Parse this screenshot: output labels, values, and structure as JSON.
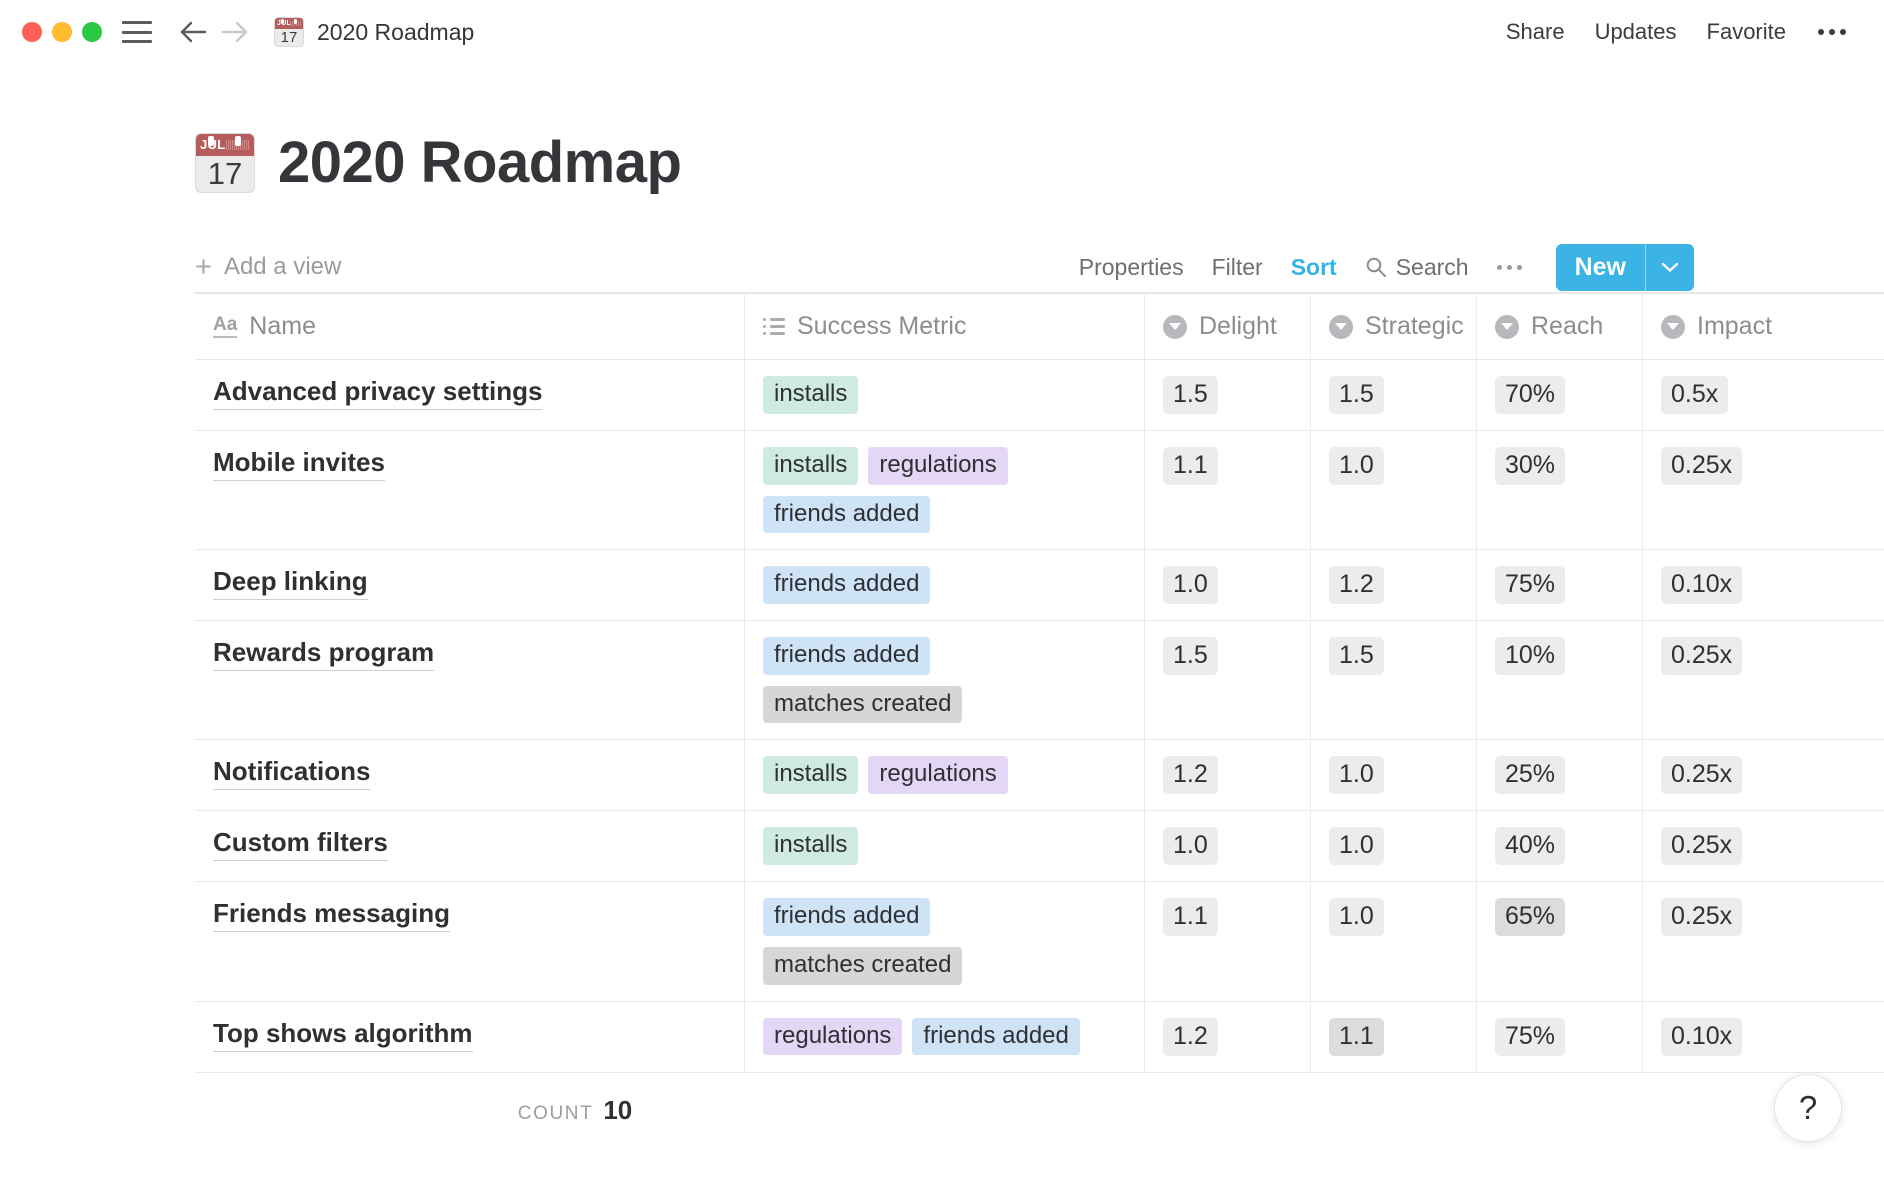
{
  "titlebar": {
    "breadcrumb_title": "2020 Roadmap",
    "calendar_month": "JUL",
    "calendar_day": "17",
    "actions": [
      {
        "label": "Share",
        "name": "share-button"
      },
      {
        "label": "Updates",
        "name": "updates-button"
      },
      {
        "label": "Favorite",
        "name": "favorite-button"
      }
    ]
  },
  "page": {
    "title": "2020 Roadmap",
    "calendar_month": "JUL",
    "calendar_day": "17"
  },
  "viewbar": {
    "add_view_label": "Add a view",
    "properties_label": "Properties",
    "filter_label": "Filter",
    "sort_label": "Sort",
    "search_label": "Search",
    "new_label": "New",
    "accent_color": "#3cb3e5",
    "active_item": "Sort"
  },
  "table": {
    "columns": [
      {
        "label": "Name",
        "icon": "text-aa-icon"
      },
      {
        "label": "Success Metric",
        "icon": "multi-select-list-icon"
      },
      {
        "label": "Delight",
        "icon": "select-icon"
      },
      {
        "label": "Strategic",
        "icon": "select-icon"
      },
      {
        "label": "Reach",
        "icon": "select-icon"
      },
      {
        "label": "Impact",
        "icon": "select-icon"
      }
    ],
    "rows": [
      {
        "name": "Advanced privacy settings",
        "metrics": [
          {
            "label": "installs",
            "color": "green"
          }
        ],
        "delight": "1.5",
        "delight_dark": false,
        "strategic": "1.5",
        "strategic_dark": false,
        "reach": "70%",
        "reach_dark": false,
        "impact": "0.5x",
        "impact_dark": false
      },
      {
        "name": "Mobile invites",
        "metrics": [
          {
            "label": "installs",
            "color": "green"
          },
          {
            "label": "regulations",
            "color": "purple"
          },
          {
            "label": "friends added",
            "color": "blue"
          }
        ],
        "delight": "1.1",
        "delight_dark": false,
        "strategic": "1.0",
        "strategic_dark": false,
        "reach": "30%",
        "reach_dark": false,
        "impact": "0.25x",
        "impact_dark": false
      },
      {
        "name": "Deep linking",
        "metrics": [
          {
            "label": "friends added",
            "color": "blue"
          }
        ],
        "delight": "1.0",
        "delight_dark": false,
        "strategic": "1.2",
        "strategic_dark": false,
        "reach": "75%",
        "reach_dark": false,
        "impact": "0.10x",
        "impact_dark": false
      },
      {
        "name": "Rewards program",
        "metrics": [
          {
            "label": "friends added",
            "color": "blue"
          },
          {
            "label": "matches created",
            "color": "gray"
          }
        ],
        "delight": "1.5",
        "delight_dark": false,
        "strategic": "1.5",
        "strategic_dark": false,
        "reach": "10%",
        "reach_dark": false,
        "impact": "0.25x",
        "impact_dark": false
      },
      {
        "name": "Notifications",
        "metrics": [
          {
            "label": "installs",
            "color": "green"
          },
          {
            "label": "regulations",
            "color": "purple"
          }
        ],
        "delight": "1.2",
        "delight_dark": false,
        "strategic": "1.0",
        "strategic_dark": false,
        "reach": "25%",
        "reach_dark": false,
        "impact": "0.25x",
        "impact_dark": false
      },
      {
        "name": "Custom filters",
        "metrics": [
          {
            "label": "installs",
            "color": "green"
          }
        ],
        "delight": "1.0",
        "delight_dark": false,
        "strategic": "1.0",
        "strategic_dark": false,
        "reach": "40%",
        "reach_dark": false,
        "impact": "0.25x",
        "impact_dark": false
      },
      {
        "name": "Friends messaging",
        "metrics": [
          {
            "label": "friends added",
            "color": "blue"
          },
          {
            "label": "matches created",
            "color": "gray"
          }
        ],
        "delight": "1.1",
        "delight_dark": false,
        "strategic": "1.0",
        "strategic_dark": false,
        "reach": "65%",
        "reach_dark": true,
        "impact": "0.25x",
        "impact_dark": false
      },
      {
        "name": "Top shows algorithm",
        "metrics": [
          {
            "label": "regulations",
            "color": "purple"
          },
          {
            "label": "friends added",
            "color": "blue"
          }
        ],
        "delight": "1.2",
        "delight_dark": false,
        "strategic": "1.1",
        "strategic_dark": true,
        "reach": "75%",
        "reach_dark": false,
        "impact": "0.10x",
        "impact_dark": false
      }
    ],
    "count_label": "COUNT",
    "count_value": "10"
  },
  "help": {
    "glyph": "?"
  }
}
